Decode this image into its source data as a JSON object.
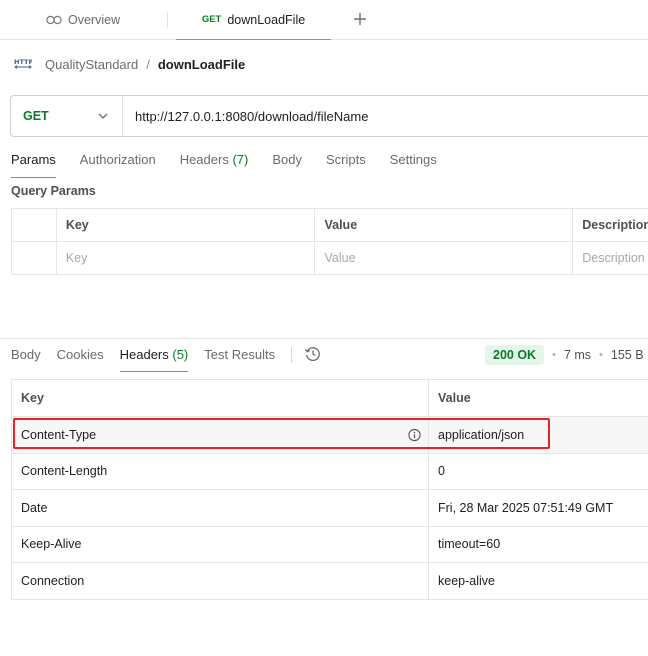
{
  "colors": {
    "accent": "#e8653a",
    "method_get": "#0b7a28",
    "status_ok_bg": "#e5f5e9",
    "highlight": "#e5212b"
  },
  "tabs": {
    "overview": {
      "label": "Overview",
      "icon": "overview-icon"
    },
    "active": {
      "method": "GET",
      "label": "downLoadFile"
    },
    "new_tab_icon": "plus-icon"
  },
  "breadcrumb": {
    "icon": "http-icon",
    "parent": "QualityStandard",
    "separator": "/",
    "current": "downLoadFile"
  },
  "request": {
    "method": "GET",
    "url": "http://127.0.0.1:8080/download/fileName",
    "tabs": {
      "params": "Params",
      "authorization": "Authorization",
      "headers_label": "Headers",
      "headers_count": "(7)",
      "body": "Body",
      "scripts": "Scripts",
      "settings": "Settings"
    },
    "query_params_title": "Query Params",
    "params_table": {
      "headers": [
        "Key",
        "Value",
        "Description"
      ],
      "placeholders": [
        "Key",
        "Value",
        "Description"
      ]
    }
  },
  "response": {
    "tabs": {
      "body": "Body",
      "cookies": "Cookies",
      "headers_label": "Headers",
      "headers_count": "(5)",
      "test_results": "Test Results"
    },
    "status": "200 OK",
    "time": "7 ms",
    "size": "155 B",
    "headers_table": {
      "columns": [
        "Key",
        "Value"
      ],
      "rows": [
        {
          "key": "Content-Type",
          "value": "application/json",
          "highlighted": true
        },
        {
          "key": "Content-Length",
          "value": "0"
        },
        {
          "key": "Date",
          "value": "Fri, 28 Mar 2025 07:51:49 GMT"
        },
        {
          "key": "Keep-Alive",
          "value": "timeout=60"
        },
        {
          "key": "Connection",
          "value": "keep-alive"
        }
      ]
    }
  }
}
